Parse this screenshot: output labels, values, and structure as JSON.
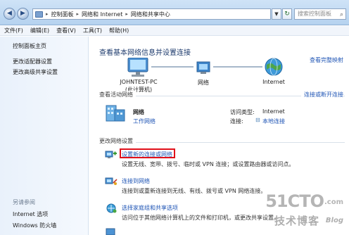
{
  "address": {
    "crumbs": [
      "控制面板",
      "网络和 Internet",
      "网络和共享中心"
    ],
    "search_placeholder": "搜索控制面板"
  },
  "menu": [
    "文件(F)",
    "编辑(E)",
    "查看(V)",
    "工具(T)",
    "帮助(H)"
  ],
  "sidebar": {
    "items": [
      {
        "label": "控制面板主页"
      },
      {
        "label": "更改适配器设置"
      },
      {
        "label": "更改高级共享设置"
      }
    ],
    "see_also_title": "另请参阅",
    "see_also": [
      {
        "label": "Internet 选项"
      },
      {
        "label": "Windows 防火墙"
      }
    ]
  },
  "main": {
    "title": "查看基本网络信息并设置连接",
    "full_map_link": "查看完整映射",
    "diagram": {
      "computer_name": "JOHNTEST-PC",
      "computer_sub": "(此计算机)",
      "network_label": "网络",
      "internet_label": "Internet"
    },
    "active_networks": {
      "header": "查看活动网络",
      "connect_link": "连接或断开连接",
      "network_name": "网络",
      "network_type": "工作网络",
      "access_type_label": "访问类型:",
      "access_type_value": "Internet",
      "connection_label": "连接:",
      "connection_value": "本地连接"
    },
    "change_settings": {
      "header": "更改网络设置",
      "tasks": [
        {
          "title": "设置新的连接或网络",
          "desc": "设置无线、宽带、拨号、临时或 VPN 连接；或设置路由器或访问点。"
        },
        {
          "title": "连接到网络",
          "desc": "连接到或重新连接到无线、有线、拨号或 VPN 网络连接。"
        },
        {
          "title": "选择家庭组和共享选项",
          "desc": "访问位于其他网络计算机上的文件和打印机，或更改共享设置。"
        }
      ]
    }
  },
  "watermark": {
    "main": "51CTO",
    "com": ".com",
    "sub": "技术博客",
    "blog": "Blog"
  }
}
